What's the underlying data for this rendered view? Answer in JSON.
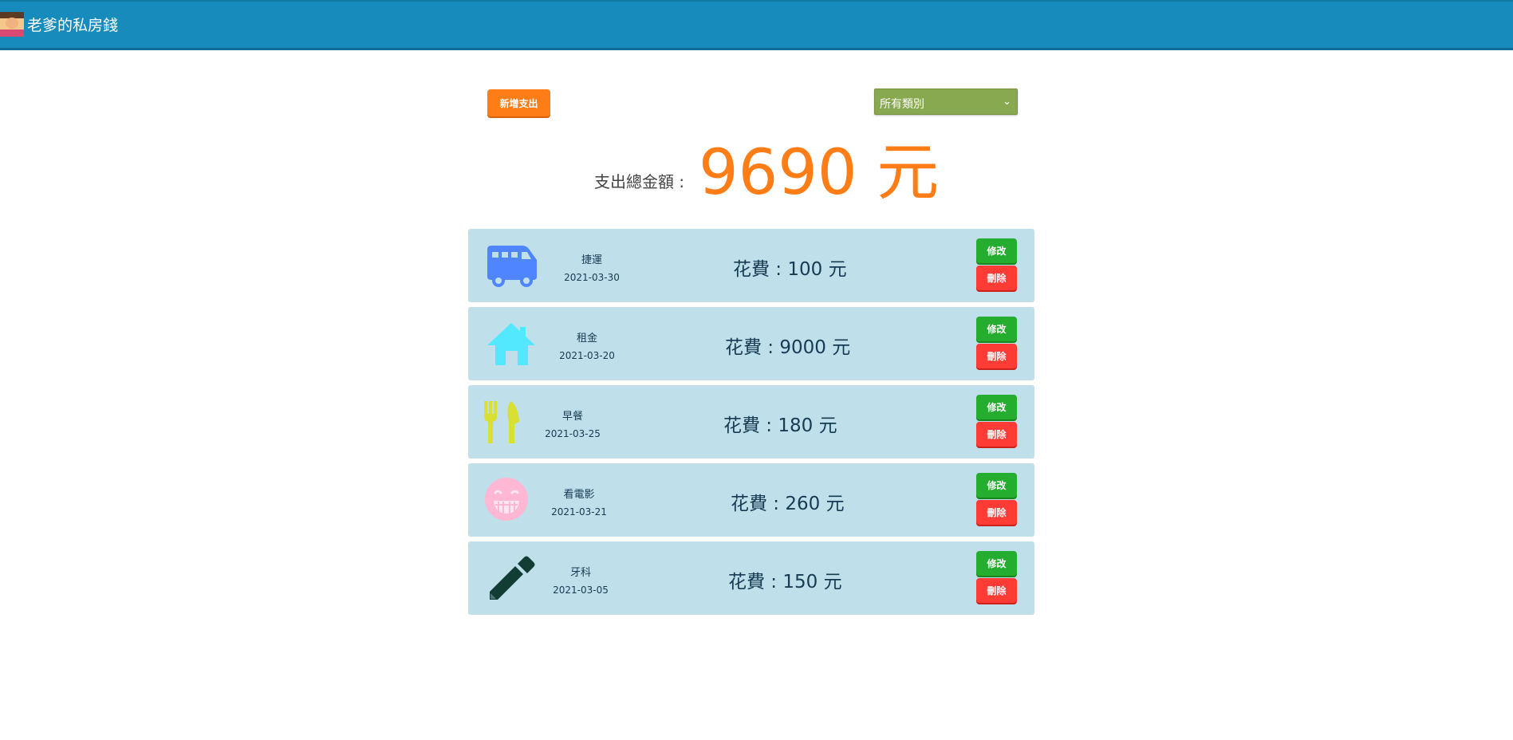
{
  "app": {
    "title": "老爹的私房錢"
  },
  "toolbar": {
    "add_label": "新增支出",
    "category_filter": {
      "selected": "所有類別"
    }
  },
  "summary": {
    "label": "支出總金額 :",
    "amount": "9690 元"
  },
  "expenses": [
    {
      "icon": "bus-icon",
      "color": "#4f86ff",
      "category": "捷運",
      "date": "2021-03-30",
      "amount_text": "花費 : 100 元",
      "edit_label": "修改",
      "delete_label": "刪除"
    },
    {
      "icon": "house-icon",
      "color": "#54e8ff",
      "category": "租金",
      "date": "2021-03-20",
      "amount_text": "花費 : 9000 元",
      "edit_label": "修改",
      "delete_label": "刪除"
    },
    {
      "icon": "utensils-icon",
      "color": "#d9df33",
      "category": "早餐",
      "date": "2021-03-25",
      "amount_text": "花費 : 180 元",
      "edit_label": "修改",
      "delete_label": "刪除"
    },
    {
      "icon": "smile-icon",
      "color": "#ffb7d3",
      "category": "看電影",
      "date": "2021-03-21",
      "amount_text": "花費 : 260 元",
      "edit_label": "修改",
      "delete_label": "刪除"
    },
    {
      "icon": "pencil-icon",
      "color": "#113d35",
      "category": "牙科",
      "date": "2021-03-05",
      "amount_text": "花費 : 150 元",
      "edit_label": "修改",
      "delete_label": "刪除"
    }
  ]
}
